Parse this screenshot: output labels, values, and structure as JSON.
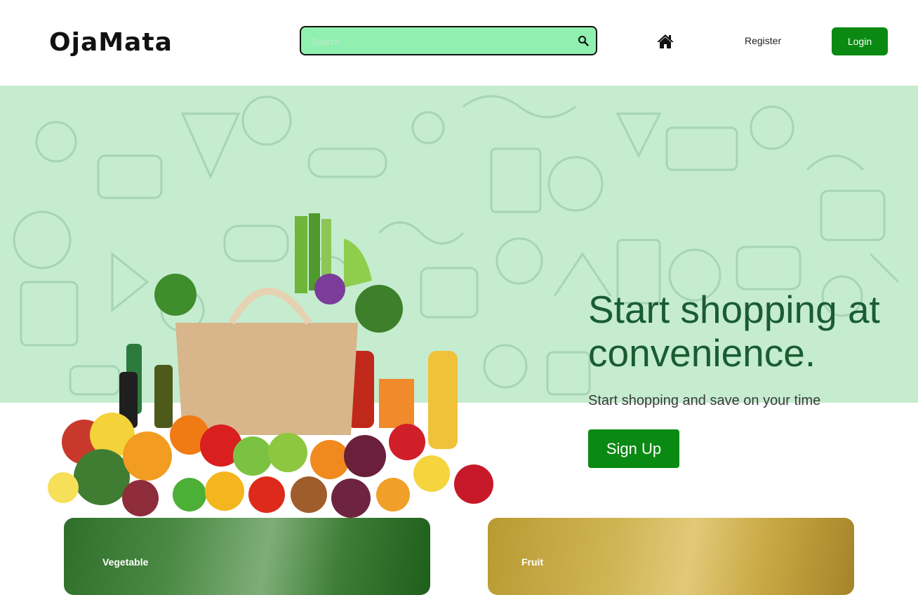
{
  "header": {
    "logo": "OjaMata",
    "search": {
      "placeholder": "Search",
      "value": ""
    },
    "nav": {
      "register_label": "Register",
      "login_label": "Login"
    }
  },
  "hero": {
    "title": "Start shopping at convenience.",
    "subtitle": "Start shopping and save on your time",
    "signup_label": "Sign Up"
  },
  "categories": [
    {
      "label": "Vegetable"
    },
    {
      "label": "Fruit"
    }
  ],
  "colors": {
    "brand_green": "#0a8a12",
    "search_bg": "#8ff0b0",
    "hero_bg": "#c5eccf",
    "hero_title": "#1a5c32"
  },
  "icons": {
    "search": "search-icon",
    "home": "home-icon"
  }
}
